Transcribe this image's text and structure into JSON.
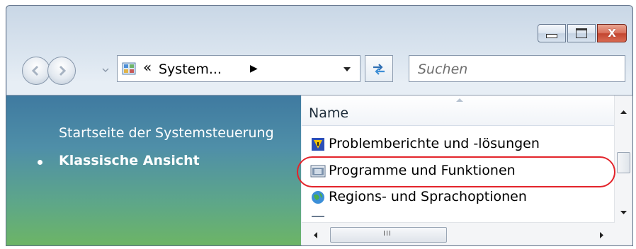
{
  "window": {
    "caption_buttons": {
      "minimize": "minimize",
      "maximize": "maximize",
      "close": "X"
    }
  },
  "navigation": {
    "address_chevron": "«",
    "address_path": "System...",
    "address_arrow": "▶",
    "search_placeholder": "Suchen"
  },
  "task_pane": {
    "link": "Startseite der Systemsteuerung",
    "current_view": "Klassische Ansicht"
  },
  "file_list": {
    "column_header": "Name",
    "items": [
      {
        "label": "Problemberichte und -lösungen",
        "icon": "problem-reports-icon"
      },
      {
        "label": "Programme und Funktionen",
        "icon": "programs-features-icon",
        "highlighted": true
      },
      {
        "label": "Regions- und Sprachoptionen",
        "icon": "regional-options-icon"
      }
    ],
    "highlight_color": "#e3242b"
  },
  "scrollbar": {
    "h_grip": "III"
  },
  "colors": {
    "task_pane_top": "#3f7aa0",
    "task_pane_bottom": "#6db565",
    "close_button": "#c34630"
  }
}
